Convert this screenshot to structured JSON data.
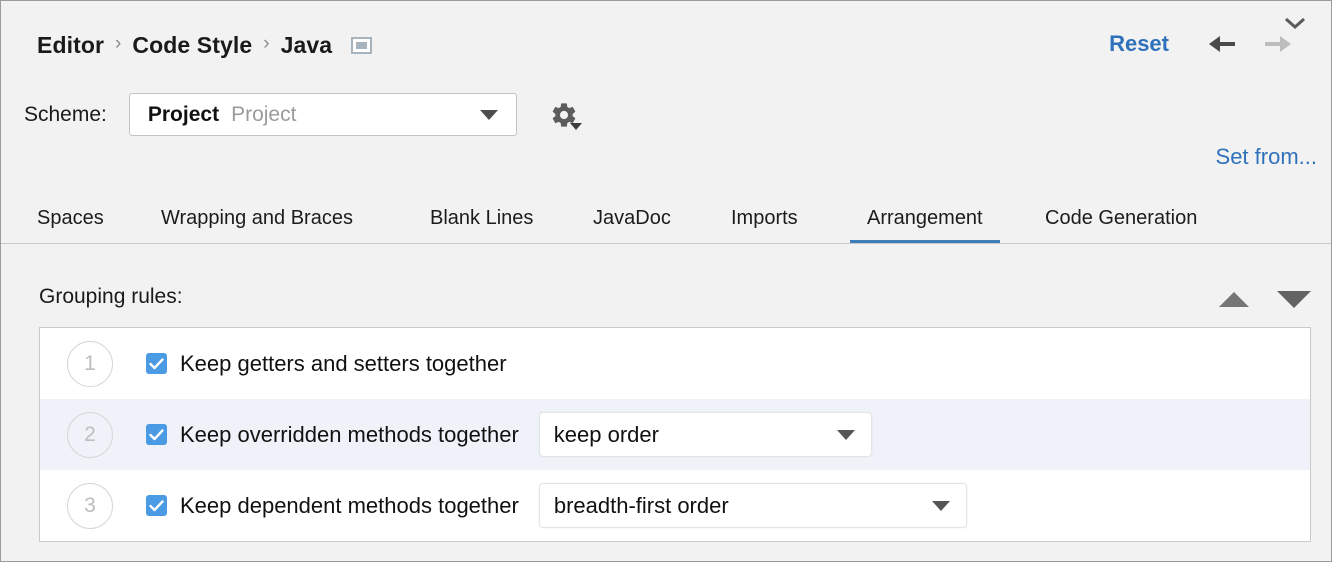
{
  "header": {
    "breadcrumb": [
      "Editor",
      "Code Style",
      "Java"
    ],
    "separator": "›",
    "modality_icon": "window-icon",
    "reset_label": "Reset",
    "back_icon": "arrow-left-icon",
    "forward_icon": "arrow-right-icon"
  },
  "scheme": {
    "label": "Scheme:",
    "value": "Project",
    "value_secondary": "Project",
    "dropdown_icon": "triangle-down-icon",
    "gear_icon": "gear-icon"
  },
  "set_from": {
    "label": "Set from..."
  },
  "tabs": {
    "items": [
      {
        "label": "Spaces",
        "selected": false
      },
      {
        "label": "Wrapping and Braces",
        "selected": false
      },
      {
        "label": "Blank Lines",
        "selected": false
      },
      {
        "label": "JavaDoc",
        "selected": false
      },
      {
        "label": "Imports",
        "selected": false
      },
      {
        "label": "Arrangement",
        "selected": true
      },
      {
        "label": "Code Generation",
        "selected": false
      }
    ],
    "overflow_icon": "chevron-down-icon"
  },
  "grouping": {
    "title": "Grouping rules:",
    "move_up_icon": "triangle-up-icon",
    "move_down_icon": "triangle-down-icon",
    "rules": [
      {
        "number": "1",
        "checked": true,
        "label": "Keep getters and setters together",
        "combo": null
      },
      {
        "number": "2",
        "checked": true,
        "label": "Keep overridden methods together",
        "combo": "keep order"
      },
      {
        "number": "3",
        "checked": true,
        "label": "Keep dependent methods together",
        "combo": "breadth-first order"
      }
    ]
  },
  "colors": {
    "accent": "#3f7cb8",
    "link": "#2f71ba",
    "checkbox": "#4a9ae4",
    "row_stripe": "#eff3f9",
    "background": "#f2f2f2"
  }
}
